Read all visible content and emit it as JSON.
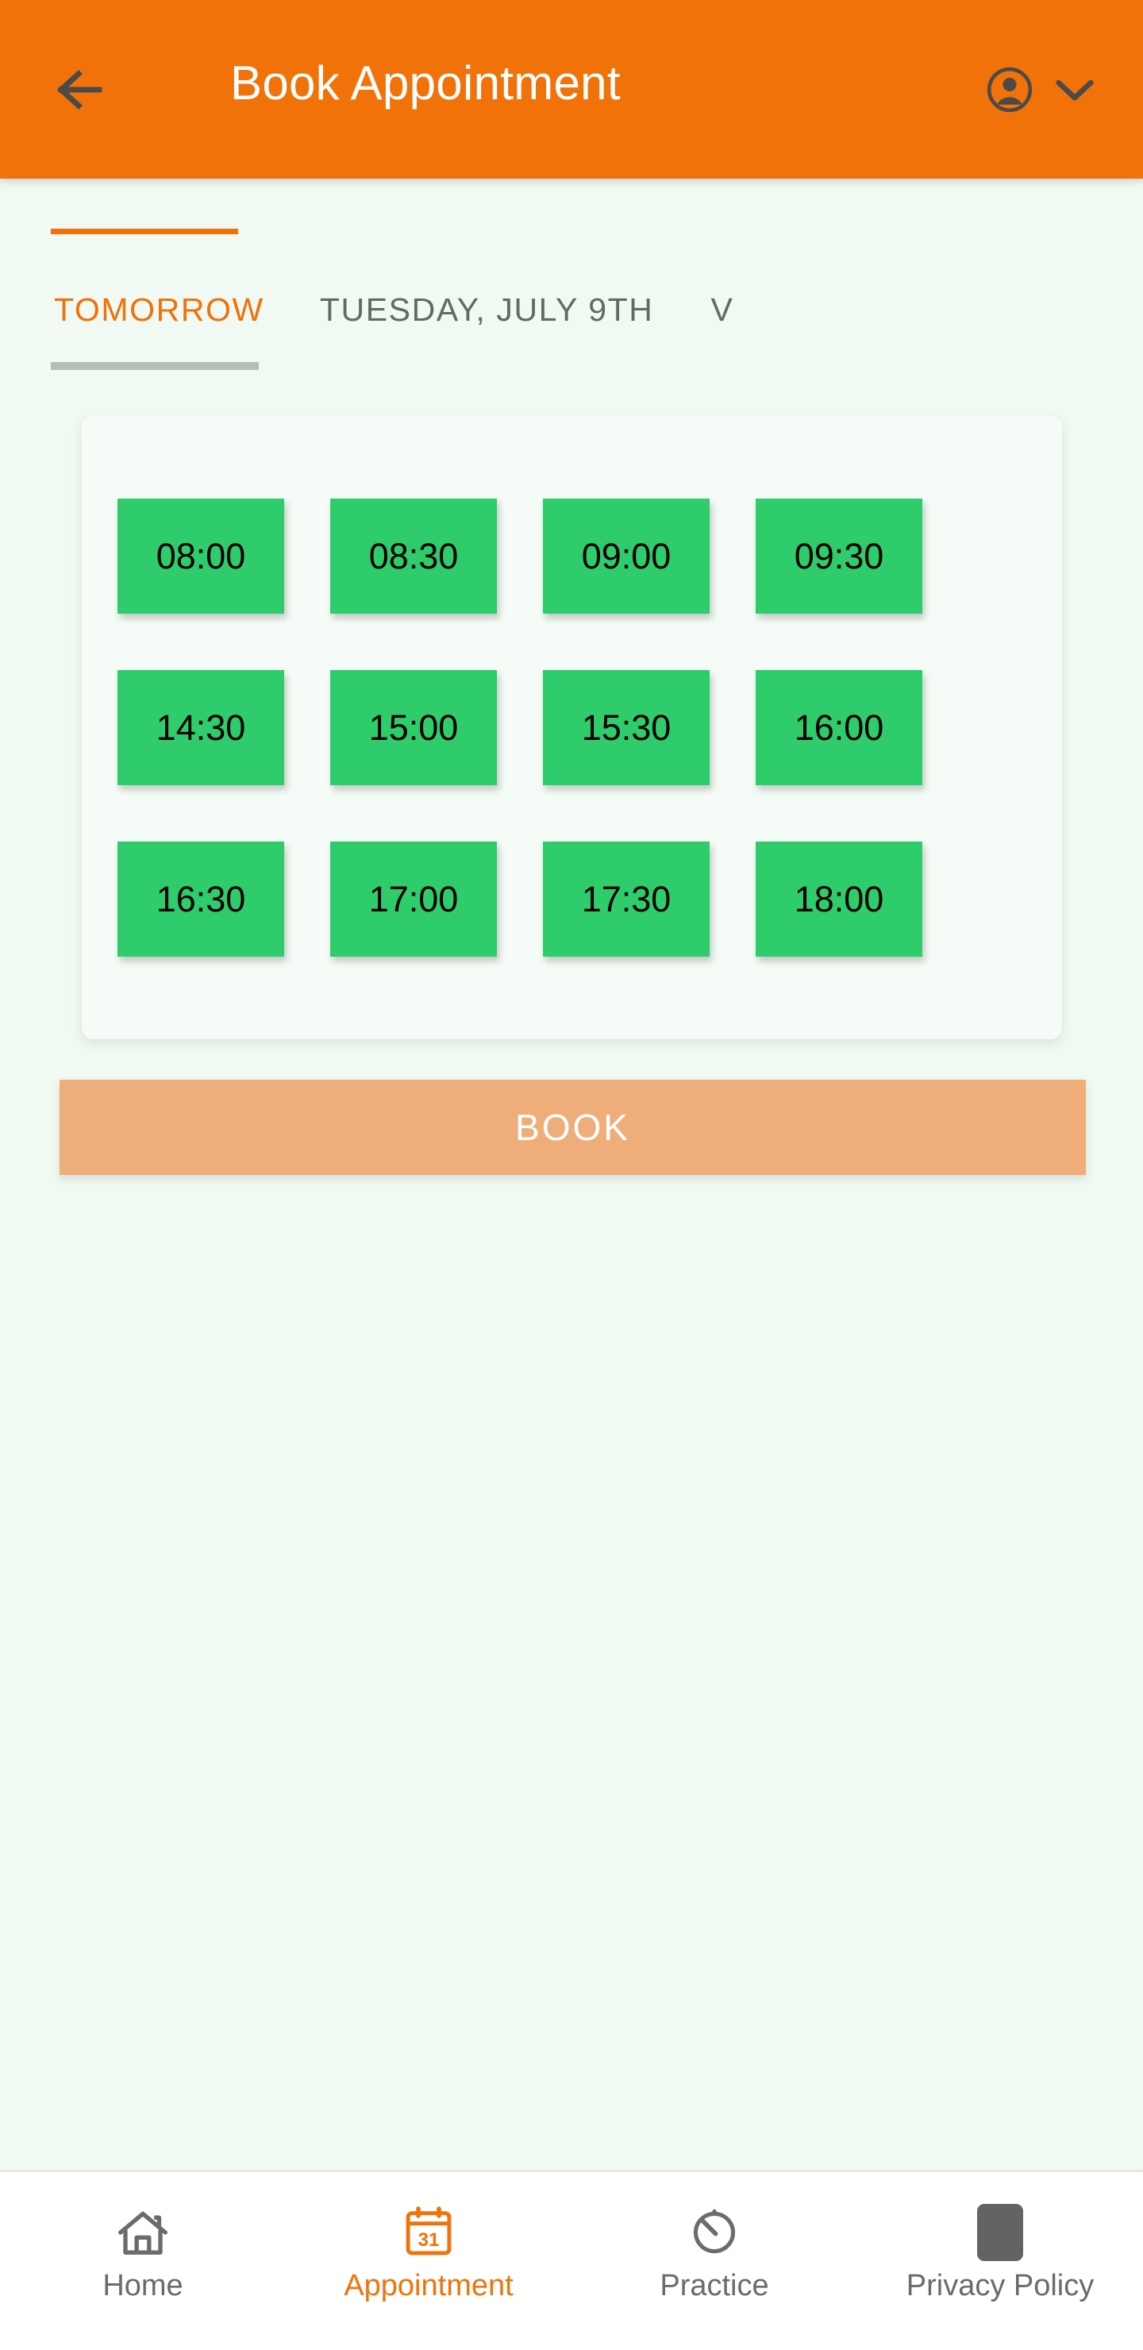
{
  "header": {
    "title": "Book Appointment",
    "back_icon": "arrow-left-icon",
    "avatar_icon": "account-circle-icon",
    "chevron_icon": "chevron-down-icon",
    "background_color": "#f07208",
    "title_color": "#ffffff",
    "icon_color": "#4a4a4a"
  },
  "tabs": {
    "active_index": 0,
    "indicator_color": "#f07208",
    "items": [
      {
        "label": "TOMORROW",
        "active": true
      },
      {
        "label": "TUESDAY, JULY 9TH",
        "active": false
      },
      {
        "label": "V",
        "active": false
      }
    ]
  },
  "slots": {
    "available_color": "#2ecc6b",
    "text_color": "#000000",
    "rows": [
      [
        "08:00",
        "08:30",
        "09:00",
        "09:30"
      ],
      [
        "14:30",
        "15:00",
        "15:30",
        "16:00"
      ],
      [
        "16:30",
        "17:00",
        "17:30",
        "18:00"
      ]
    ]
  },
  "book_button": {
    "label": "BOOK",
    "color": "#efae79",
    "text_color": "#ffffff",
    "enabled": false
  },
  "bottom_nav": {
    "active_color": "#f07208",
    "inactive_color": "#6b6b6b",
    "items": [
      {
        "label": "Home",
        "icon": "home-icon",
        "active": false
      },
      {
        "label": "Appointment",
        "icon": "calendar-31-icon",
        "active": true
      },
      {
        "label": "Practice",
        "icon": "timer-icon",
        "active": false
      },
      {
        "label": "Privacy Policy",
        "icon": "document-square-icon",
        "active": false
      }
    ]
  },
  "page": {
    "background_color": "#f1f9f3",
    "card_color": "#f5fbf6"
  }
}
